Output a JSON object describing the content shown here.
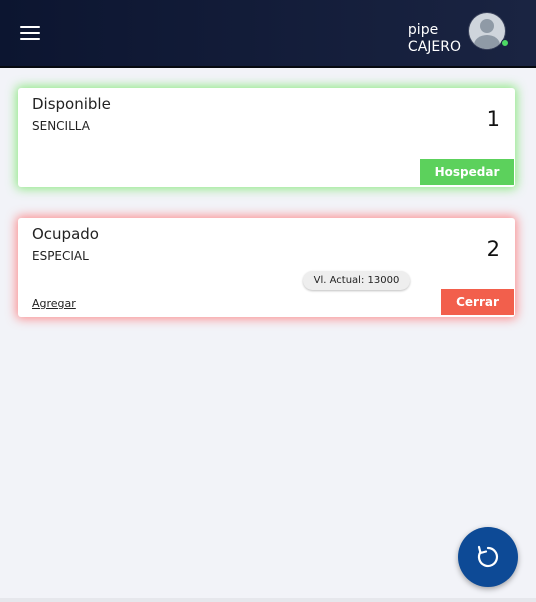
{
  "header": {
    "user_name": "pipe",
    "user_role": "CAJERO",
    "menu_icon": "hamburger-icon",
    "avatar_icon": "user-avatar-icon",
    "online_status_color": "#4cd964"
  },
  "rooms": [
    {
      "status": "Disponible",
      "type": "SENCILLA",
      "number": "1",
      "status_color": "#70e660",
      "action_label": "Hospedar",
      "action_color": "#5cd15c"
    },
    {
      "status": "Ocupado",
      "type": "ESPECIAL",
      "number": "2",
      "status_color": "#ff6e6e",
      "value_label": "Vl. Actual: 13000",
      "link_label": "Agregar",
      "action_label": "Cerrar",
      "action_color": "#f25f4c"
    }
  ],
  "fab": {
    "icon": "refresh-icon",
    "color": "#0d4a96"
  }
}
